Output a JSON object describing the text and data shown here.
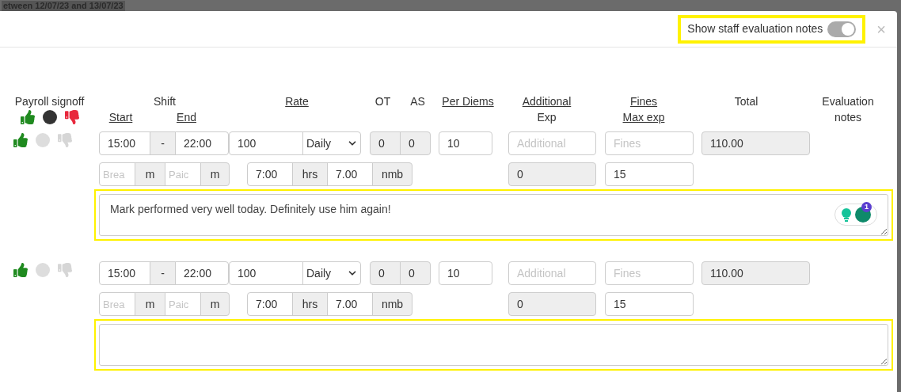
{
  "backdrop_text": "etween 12/07/23 and 13/07/23",
  "header": {
    "toggle": {
      "label": "Show staff evaluation notes",
      "on": true,
      "highlighted": true
    },
    "close": "×"
  },
  "columns": {
    "signoff": "Payroll signoff",
    "shift": "Shift",
    "start": "Start",
    "end": "End",
    "rate": "Rate",
    "ot": "OT",
    "as": "AS",
    "per_diems": "Per Diems",
    "additional": "Additional",
    "additional_sub": "Exp",
    "fines": "Fines",
    "fines_sub": "Max exp",
    "total": "Total",
    "evaluation": "Evaluation notes"
  },
  "signoff_legend": [
    {
      "kind": "approve",
      "selected": true
    },
    {
      "kind": "neutral",
      "selected": true
    },
    {
      "kind": "reject",
      "selected": true
    }
  ],
  "rows": [
    {
      "signoff": [
        {
          "kind": "approve",
          "selected": true
        },
        {
          "kind": "neutral",
          "selected": false
        },
        {
          "kind": "reject",
          "selected": false
        }
      ],
      "start": "15:00",
      "separator": "-",
      "end": "22:00",
      "rate": "100",
      "rate_unit": "Daily",
      "ot": "0",
      "as": "0",
      "per_diems": "10",
      "additional_placeholder": "Additional",
      "fines_placeholder": "Fines",
      "total": "110.00",
      "break_placeholder": "Brea",
      "break_unit": "m",
      "paid_placeholder": "Paic",
      "paid_unit": "m",
      "hours": "7:00",
      "hours_unit": "hrs",
      "nmb": "7.00",
      "nmb_unit": "nmb",
      "additional_max": "0",
      "fines_max": "15",
      "note": "Mark performed very well today. Definitely use him again!",
      "note_highlighted": true,
      "assistant_badge": "1"
    },
    {
      "signoff": [
        {
          "kind": "approve",
          "selected": true
        },
        {
          "kind": "neutral",
          "selected": false
        },
        {
          "kind": "reject",
          "selected": false
        }
      ],
      "start": "15:00",
      "separator": "-",
      "end": "22:00",
      "rate": "100",
      "rate_unit": "Daily",
      "ot": "0",
      "as": "0",
      "per_diems": "10",
      "additional_placeholder": "Additional",
      "fines_placeholder": "Fines",
      "total": "110.00",
      "break_placeholder": "Brea",
      "break_unit": "m",
      "paid_placeholder": "Paic",
      "paid_unit": "m",
      "hours": "7:00",
      "hours_unit": "hrs",
      "nmb": "7.00",
      "nmb_unit": "nmb",
      "additional_max": "0",
      "fines_max": "15",
      "note_highlighted": true
    }
  ]
}
